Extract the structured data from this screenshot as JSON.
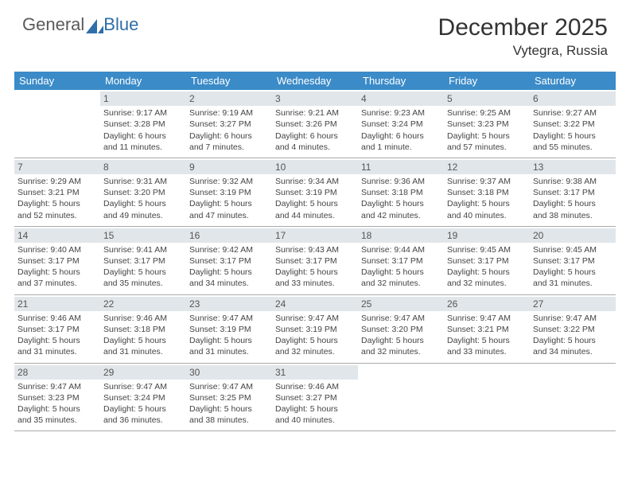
{
  "logo": {
    "part1": "General",
    "part2": "Blue"
  },
  "title": "December 2025",
  "location": "Vytegra, Russia",
  "daynames": [
    "Sunday",
    "Monday",
    "Tuesday",
    "Wednesday",
    "Thursday",
    "Friday",
    "Saturday"
  ],
  "weeks": [
    [
      {
        "n": "",
        "sr": "",
        "ss": "",
        "d1": "",
        "d2": ""
      },
      {
        "n": "1",
        "sr": "Sunrise: 9:17 AM",
        "ss": "Sunset: 3:28 PM",
        "d1": "Daylight: 6 hours",
        "d2": "and 11 minutes."
      },
      {
        "n": "2",
        "sr": "Sunrise: 9:19 AM",
        "ss": "Sunset: 3:27 PM",
        "d1": "Daylight: 6 hours",
        "d2": "and 7 minutes."
      },
      {
        "n": "3",
        "sr": "Sunrise: 9:21 AM",
        "ss": "Sunset: 3:26 PM",
        "d1": "Daylight: 6 hours",
        "d2": "and 4 minutes."
      },
      {
        "n": "4",
        "sr": "Sunrise: 9:23 AM",
        "ss": "Sunset: 3:24 PM",
        "d1": "Daylight: 6 hours",
        "d2": "and 1 minute."
      },
      {
        "n": "5",
        "sr": "Sunrise: 9:25 AM",
        "ss": "Sunset: 3:23 PM",
        "d1": "Daylight: 5 hours",
        "d2": "and 57 minutes."
      },
      {
        "n": "6",
        "sr": "Sunrise: 9:27 AM",
        "ss": "Sunset: 3:22 PM",
        "d1": "Daylight: 5 hours",
        "d2": "and 55 minutes."
      }
    ],
    [
      {
        "n": "7",
        "sr": "Sunrise: 9:29 AM",
        "ss": "Sunset: 3:21 PM",
        "d1": "Daylight: 5 hours",
        "d2": "and 52 minutes."
      },
      {
        "n": "8",
        "sr": "Sunrise: 9:31 AM",
        "ss": "Sunset: 3:20 PM",
        "d1": "Daylight: 5 hours",
        "d2": "and 49 minutes."
      },
      {
        "n": "9",
        "sr": "Sunrise: 9:32 AM",
        "ss": "Sunset: 3:19 PM",
        "d1": "Daylight: 5 hours",
        "d2": "and 47 minutes."
      },
      {
        "n": "10",
        "sr": "Sunrise: 9:34 AM",
        "ss": "Sunset: 3:19 PM",
        "d1": "Daylight: 5 hours",
        "d2": "and 44 minutes."
      },
      {
        "n": "11",
        "sr": "Sunrise: 9:36 AM",
        "ss": "Sunset: 3:18 PM",
        "d1": "Daylight: 5 hours",
        "d2": "and 42 minutes."
      },
      {
        "n": "12",
        "sr": "Sunrise: 9:37 AM",
        "ss": "Sunset: 3:18 PM",
        "d1": "Daylight: 5 hours",
        "d2": "and 40 minutes."
      },
      {
        "n": "13",
        "sr": "Sunrise: 9:38 AM",
        "ss": "Sunset: 3:17 PM",
        "d1": "Daylight: 5 hours",
        "d2": "and 38 minutes."
      }
    ],
    [
      {
        "n": "14",
        "sr": "Sunrise: 9:40 AM",
        "ss": "Sunset: 3:17 PM",
        "d1": "Daylight: 5 hours",
        "d2": "and 37 minutes."
      },
      {
        "n": "15",
        "sr": "Sunrise: 9:41 AM",
        "ss": "Sunset: 3:17 PM",
        "d1": "Daylight: 5 hours",
        "d2": "and 35 minutes."
      },
      {
        "n": "16",
        "sr": "Sunrise: 9:42 AM",
        "ss": "Sunset: 3:17 PM",
        "d1": "Daylight: 5 hours",
        "d2": "and 34 minutes."
      },
      {
        "n": "17",
        "sr": "Sunrise: 9:43 AM",
        "ss": "Sunset: 3:17 PM",
        "d1": "Daylight: 5 hours",
        "d2": "and 33 minutes."
      },
      {
        "n": "18",
        "sr": "Sunrise: 9:44 AM",
        "ss": "Sunset: 3:17 PM",
        "d1": "Daylight: 5 hours",
        "d2": "and 32 minutes."
      },
      {
        "n": "19",
        "sr": "Sunrise: 9:45 AM",
        "ss": "Sunset: 3:17 PM",
        "d1": "Daylight: 5 hours",
        "d2": "and 32 minutes."
      },
      {
        "n": "20",
        "sr": "Sunrise: 9:45 AM",
        "ss": "Sunset: 3:17 PM",
        "d1": "Daylight: 5 hours",
        "d2": "and 31 minutes."
      }
    ],
    [
      {
        "n": "21",
        "sr": "Sunrise: 9:46 AM",
        "ss": "Sunset: 3:17 PM",
        "d1": "Daylight: 5 hours",
        "d2": "and 31 minutes."
      },
      {
        "n": "22",
        "sr": "Sunrise: 9:46 AM",
        "ss": "Sunset: 3:18 PM",
        "d1": "Daylight: 5 hours",
        "d2": "and 31 minutes."
      },
      {
        "n": "23",
        "sr": "Sunrise: 9:47 AM",
        "ss": "Sunset: 3:19 PM",
        "d1": "Daylight: 5 hours",
        "d2": "and 31 minutes."
      },
      {
        "n": "24",
        "sr": "Sunrise: 9:47 AM",
        "ss": "Sunset: 3:19 PM",
        "d1": "Daylight: 5 hours",
        "d2": "and 32 minutes."
      },
      {
        "n": "25",
        "sr": "Sunrise: 9:47 AM",
        "ss": "Sunset: 3:20 PM",
        "d1": "Daylight: 5 hours",
        "d2": "and 32 minutes."
      },
      {
        "n": "26",
        "sr": "Sunrise: 9:47 AM",
        "ss": "Sunset: 3:21 PM",
        "d1": "Daylight: 5 hours",
        "d2": "and 33 minutes."
      },
      {
        "n": "27",
        "sr": "Sunrise: 9:47 AM",
        "ss": "Sunset: 3:22 PM",
        "d1": "Daylight: 5 hours",
        "d2": "and 34 minutes."
      }
    ],
    [
      {
        "n": "28",
        "sr": "Sunrise: 9:47 AM",
        "ss": "Sunset: 3:23 PM",
        "d1": "Daylight: 5 hours",
        "d2": "and 35 minutes."
      },
      {
        "n": "29",
        "sr": "Sunrise: 9:47 AM",
        "ss": "Sunset: 3:24 PM",
        "d1": "Daylight: 5 hours",
        "d2": "and 36 minutes."
      },
      {
        "n": "30",
        "sr": "Sunrise: 9:47 AM",
        "ss": "Sunset: 3:25 PM",
        "d1": "Daylight: 5 hours",
        "d2": "and 38 minutes."
      },
      {
        "n": "31",
        "sr": "Sunrise: 9:46 AM",
        "ss": "Sunset: 3:27 PM",
        "d1": "Daylight: 5 hours",
        "d2": "and 40 minutes."
      },
      {
        "n": "",
        "sr": "",
        "ss": "",
        "d1": "",
        "d2": ""
      },
      {
        "n": "",
        "sr": "",
        "ss": "",
        "d1": "",
        "d2": ""
      },
      {
        "n": "",
        "sr": "",
        "ss": "",
        "d1": "",
        "d2": ""
      }
    ]
  ]
}
